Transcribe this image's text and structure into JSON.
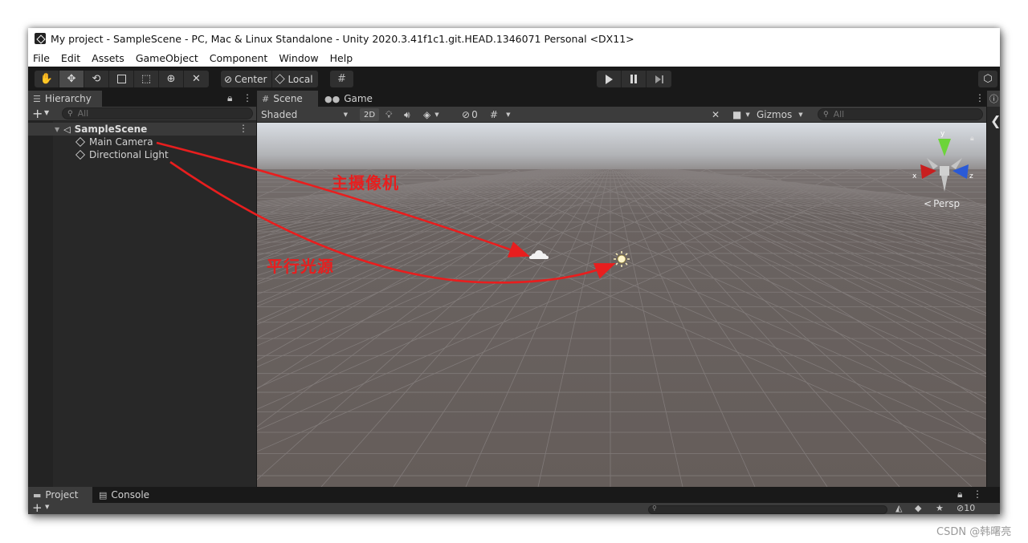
{
  "window": {
    "title": "My project - SampleScene - PC, Mac & Linux Standalone - Unity 2020.3.41f1c1.git.HEAD.1346071 Personal <DX11>"
  },
  "menu": [
    "File",
    "Edit",
    "Assets",
    "GameObject",
    "Component",
    "Window",
    "Help"
  ],
  "toolbar": {
    "pivot_label": "Center",
    "space_label": "Local"
  },
  "hierarchy": {
    "tab_label": "Hierarchy",
    "search_placeholder": "All",
    "scene_name": "SampleScene",
    "items": [
      "Main Camera",
      "Directional Light"
    ]
  },
  "scene_view": {
    "tabs": [
      "Scene",
      "Game"
    ],
    "shading_mode": "Shaded",
    "mode_2d_label": "2D",
    "hidden_count": "0",
    "gizmos_label": "Gizmos",
    "search_placeholder": "All",
    "projection_label": "Persp",
    "axis_labels": {
      "x": "x",
      "y": "y",
      "z": "z"
    }
  },
  "bottom_panel": {
    "tabs": [
      "Project",
      "Console"
    ],
    "layer_count": "10"
  },
  "annotations": {
    "camera_label": "主摄像机",
    "light_label": "平行光源",
    "arrow_color": "#e81e1e"
  },
  "watermark": "CSDN @韩曙亮",
  "colors": {
    "editor_dark": "#191919",
    "panel": "#282828",
    "tab_active": "#3c3c3c",
    "gizmo_y": "#6cd43a",
    "gizmo_x": "#c81e1e",
    "gizmo_z": "#2a5ad6"
  }
}
